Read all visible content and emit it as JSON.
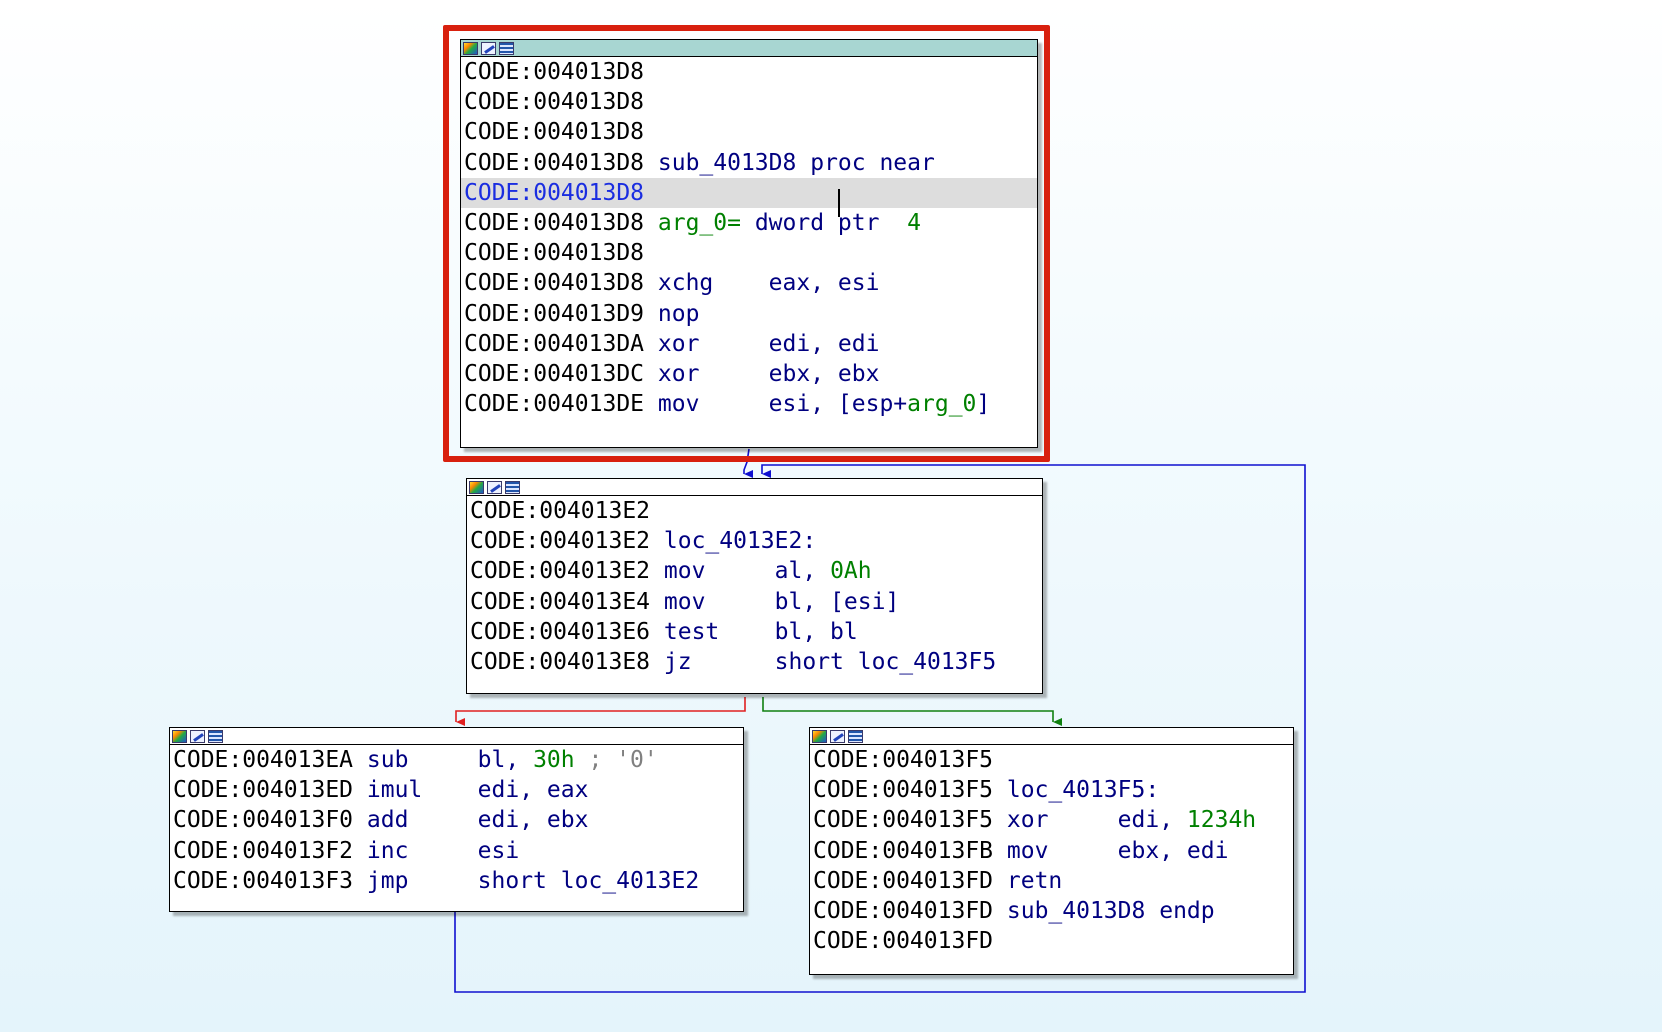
{
  "colors": {
    "edge_true": "#1010d0",
    "edge_false_red": "#e02020",
    "edge_green": "#108010",
    "frame": "#d8200e",
    "header_active": "#a8d6d2"
  },
  "header_icons": [
    "graph-icon",
    "edit-icon",
    "list-icon"
  ],
  "blocks": {
    "b1": {
      "lines": [
        {
          "addr": "CODE:004013D8",
          "mn": "",
          "op1": "",
          "op2": ""
        },
        {
          "addr": "CODE:004013D8",
          "mn": "",
          "op1": "",
          "op2": ""
        },
        {
          "addr": "CODE:004013D8",
          "mn": "",
          "op1": "",
          "op2": ""
        },
        {
          "addr": "CODE:004013D8",
          "label": "sub_4013D8",
          "kw": "proc near"
        },
        {
          "addr": "CODE:004013D8"
        },
        {
          "addr": "CODE:004013D8",
          "var": "arg_0=",
          "kw": "dword ptr",
          "num": "4"
        },
        {
          "addr": "CODE:004013D8"
        },
        {
          "addr": "CODE:004013D8",
          "mn": "xchg",
          "op": "eax, esi"
        },
        {
          "addr": "CODE:004013D9",
          "mn": "nop"
        },
        {
          "addr": "CODE:004013DA",
          "mn": "xor",
          "op": "edi, edi"
        },
        {
          "addr": "CODE:004013DC",
          "mn": "xor",
          "op": "ebx, ebx"
        },
        {
          "addr": "CODE:004013DE",
          "mn": "mov",
          "op_a": "esi, [esp+",
          "op_var": "arg_0",
          "op_b": "]"
        }
      ]
    },
    "b2": {
      "lines": [
        {
          "addr": "CODE:004013E2"
        },
        {
          "addr": "CODE:004013E2",
          "label": "loc_4013E2:"
        },
        {
          "addr": "CODE:004013E2",
          "mn": "mov",
          "op": "al, ",
          "num": "0Ah"
        },
        {
          "addr": "CODE:004013E4",
          "mn": "mov",
          "op": "bl, [esi]"
        },
        {
          "addr": "CODE:004013E6",
          "mn": "test",
          "op": "bl, bl"
        },
        {
          "addr": "CODE:004013E8",
          "mn": "jz",
          "op": "short loc_4013F5"
        }
      ]
    },
    "b3": {
      "lines": [
        {
          "addr": "CODE:004013EA",
          "mn": "sub",
          "op": "bl, ",
          "num": "30h",
          "cmt": " ; '0'"
        },
        {
          "addr": "CODE:004013ED",
          "mn": "imul",
          "op": "edi, eax"
        },
        {
          "addr": "CODE:004013F0",
          "mn": "add",
          "op": "edi, ebx"
        },
        {
          "addr": "CODE:004013F2",
          "mn": "inc",
          "op": "esi"
        },
        {
          "addr": "CODE:004013F3",
          "mn": "jmp",
          "op": "short loc_4013E2"
        }
      ]
    },
    "b4": {
      "lines": [
        {
          "addr": "CODE:004013F5"
        },
        {
          "addr": "CODE:004013F5",
          "label": "loc_4013F5:"
        },
        {
          "addr": "CODE:004013F5",
          "mn": "xor",
          "op": "edi, ",
          "num": "1234h"
        },
        {
          "addr": "CODE:004013FB",
          "mn": "mov",
          "op": "ebx, edi"
        },
        {
          "addr": "CODE:004013FD",
          "mn": "retn"
        },
        {
          "addr": "CODE:004013FD",
          "label": "sub_4013D8",
          "kw": "endp"
        },
        {
          "addr": "CODE:004013FD"
        }
      ]
    }
  }
}
